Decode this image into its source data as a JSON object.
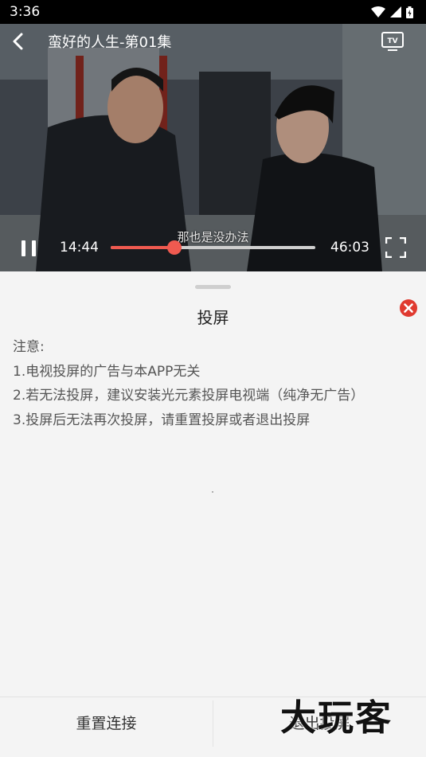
{
  "status_bar": {
    "time": "3:36"
  },
  "player": {
    "title": "蛮好的人生-第01集",
    "subtitle": "那也是没办法",
    "current_time": "14:44",
    "total_time": "46:03",
    "progress_fraction": 0.31
  },
  "cast_sheet": {
    "title": "投屏",
    "notes": [
      "注意:",
      "1.电视投屏的广告与本APP无关",
      "2.若无法投屏，建议安装光元素投屏电视端（纯净无广告）",
      "3.投屏后无法再次投屏，请重置投屏或者退出投屏"
    ]
  },
  "bottom_bar": {
    "reset_label": "重置连接",
    "exit_label": "退出投屏"
  },
  "watermark": "大玩客",
  "colors": {
    "accent": "#ef5a50",
    "close": "#e03a30"
  }
}
